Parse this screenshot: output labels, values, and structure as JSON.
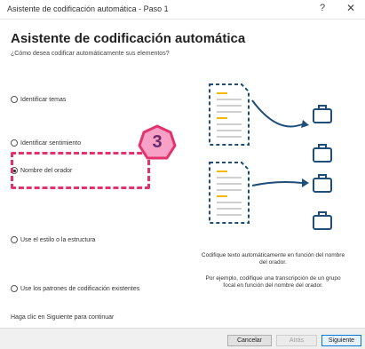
{
  "window": {
    "title": "Asistente de codificación automática - Paso 1",
    "help_glyph": "?",
    "close_glyph": "✕"
  },
  "heading": "Asistente de codificación automática",
  "subheading": "¿Cómo desea codificar automáticamente sus elementos?",
  "options": [
    {
      "label": "Identificar temas",
      "selected": false
    },
    {
      "label": "Identificar sentimiento",
      "selected": false
    },
    {
      "label": "Nombre del orador",
      "selected": true
    },
    {
      "label": "Use el estilo o la estructura",
      "selected": false
    },
    {
      "label": "Use los patrones de codificación existentes",
      "selected": false
    }
  ],
  "callout": {
    "number": "3",
    "color": "#e2336e",
    "fill": "#f7a1c6",
    "text_color": "#6b2a6b"
  },
  "description": {
    "line1": "Codifique texto automáticamente en función del nombre del orador.",
    "line2": "Por ejemplo, codifique una transcripción de un grupo focal en función del nombre del orador."
  },
  "footer_hint": "Haga clic en Siguiente para continuar",
  "buttons": {
    "cancel": "Cancelar",
    "back": "Atrás",
    "next": "Siguiente"
  },
  "colors": {
    "accent": "#1f4e79",
    "highlight_lines": "#f5b800",
    "doc_lines": "#cfcfcf"
  }
}
